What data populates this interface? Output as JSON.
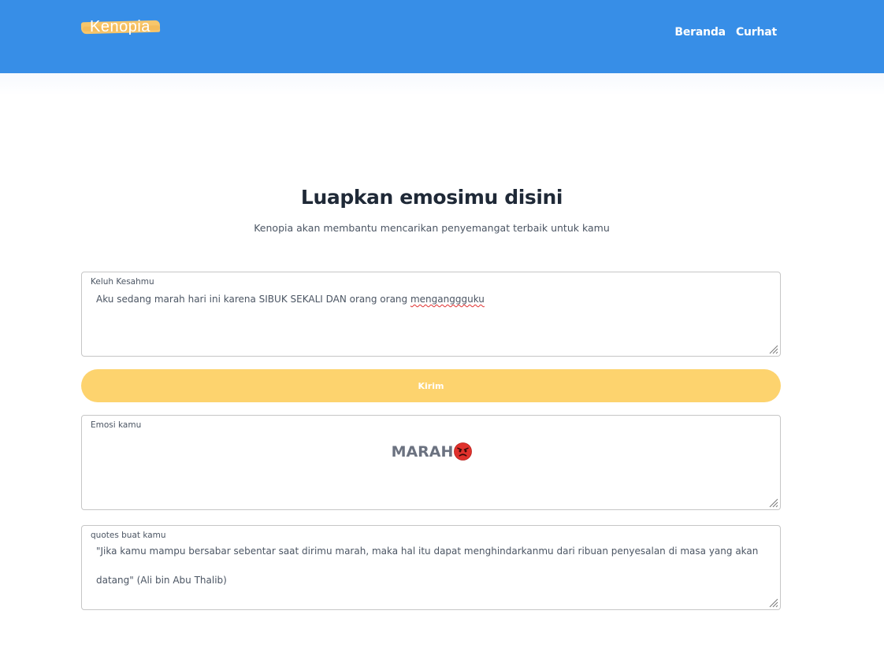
{
  "navbar": {
    "logo_text": "Kenopia",
    "links": [
      "Beranda",
      "Curhat"
    ]
  },
  "hero": {
    "title": "Luapkan emosimu disini",
    "subtitle": "Kenopia akan membantu mencarikan penyemangat terbaik untuk kamu"
  },
  "form": {
    "keluh_label": "Keluh Kesahmu",
    "keluh_value_main": "Aku sedang marah hari ini karena SIBUK SEKALI DAN orang orang ",
    "keluh_value_misspelled": "menganggguku",
    "submit_label": "Kirim",
    "emosi_label": "Emosi kamu",
    "emosi_value": "MARAH",
    "emosi_icon": "angry-face-icon",
    "quotes_label": "quotes buat kamu",
    "quotes_value": "\"Jika kamu mampu bersabar sebentar saat dirimu marah, maka hal itu dapat menghindarkanmu dari ribuan penyesalan di masa yang akan datang\" (Ali bin Abu Thalib)"
  },
  "colors": {
    "navbar": "#378ee7",
    "accent": "#fdd36e",
    "logo_brush": "#f7c66b"
  }
}
